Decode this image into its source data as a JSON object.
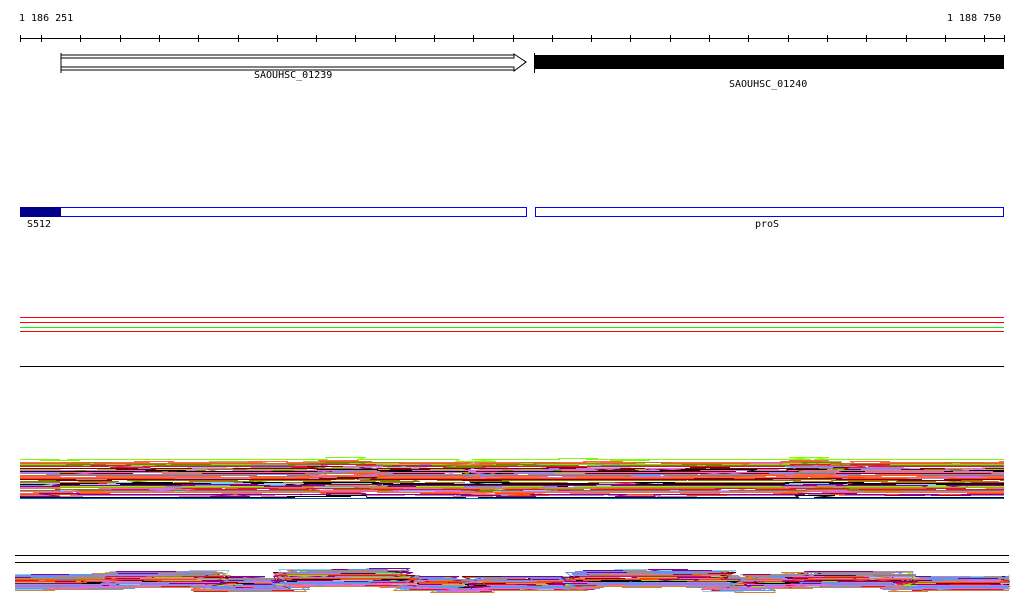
{
  "ruler": {
    "start_label": "1 186 251",
    "end_label": "1 188 750"
  },
  "genes": [
    {
      "name": "SAOUHSC_01239",
      "strand": "+",
      "style": "open-arrow"
    },
    {
      "name": "SAOUHSC_01240",
      "strand": "-",
      "style": "filled"
    }
  ],
  "features": [
    {
      "name": "S512",
      "color": "#00008b"
    },
    {
      "name": "proS",
      "color": "#0000ff"
    }
  ],
  "tracks": {
    "thin_line_colors": [
      "#ff0000",
      "#ff0000",
      "#00ff00",
      "#ff0000"
    ],
    "coverage_palette": [
      "#808000",
      "#7cfc00",
      "#d2691e",
      "#dc143c",
      "#8b008b",
      "#ff6347",
      "#c080c0",
      "#000000",
      "#87ceeb",
      "#6495ed",
      "#cd853f",
      "#bc8f8f",
      "#ff4500",
      "#9acd32",
      "#800000",
      "#da70d6"
    ]
  }
}
